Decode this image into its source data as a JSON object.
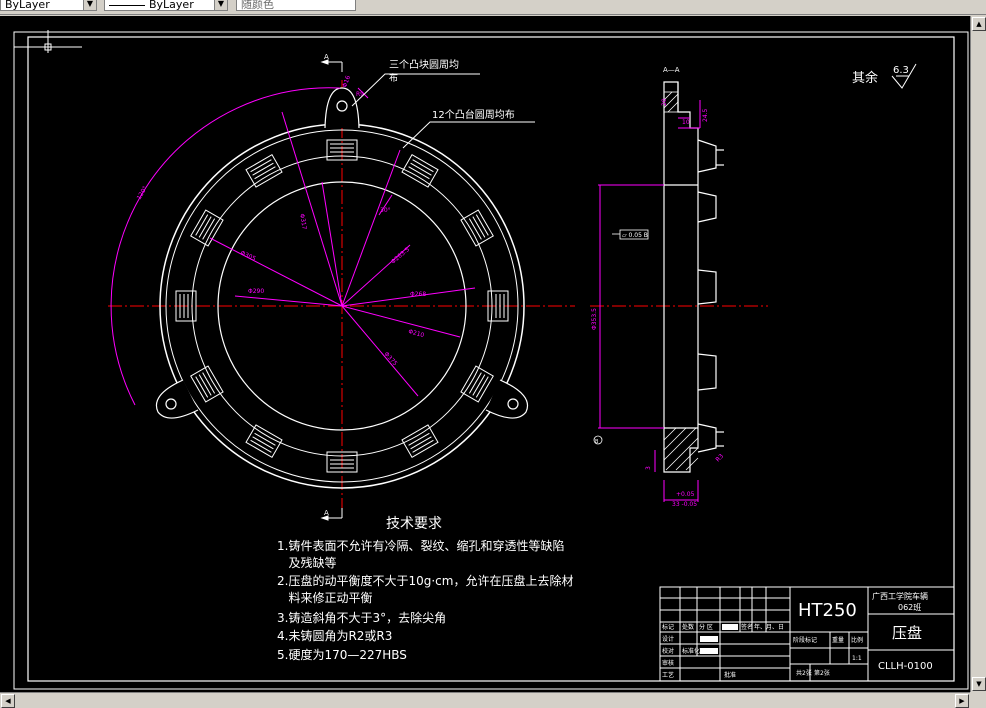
{
  "toolbar": {
    "layer_combo": "ByLayer",
    "linetype_combo": "ByLayer",
    "color_combo": "随颜色"
  },
  "drawing": {
    "annotation_bosses": "三个凸块圆周均",
    "annotation_bosses_2": "布",
    "annotation_pads": "12个凸台圆周均布",
    "section_label": "A—A",
    "datum_a": "A",
    "roughness_note": "其余",
    "roughness_value": "6.3",
    "flatness_frame": "⏥ 0.05 B",
    "datum_b": "B",
    "dim_outer_dia": "Φ375",
    "dim_mid_dia": "Φ317",
    "dim_inner_dia": "Φ210",
    "dim_h8": "Φ263.5",
    "dim_d1": "Φ16",
    "dim_d2": "R9",
    "dim_d3": "30°",
    "dim_d4": "Φ305",
    "dim_d5": "Φ290",
    "dim_d6": "Φ268",
    "dim_angle": "120°",
    "dim_vertical": "Φ353.5",
    "dim_thickness": "33 -0.05",
    "dim_thickness_tol": "+0.05",
    "dim_top": "20",
    "dim_top2": "10",
    "dim_top3": "24.5",
    "dim_small": "3",
    "dim_chamfer": "R3"
  },
  "requirements": {
    "title": "技术要求",
    "items": [
      "1.铸件表面不允许有冷隔、裂纹、缩孔和穿透性等缺陷",
      "   及残缺等",
      "2.压盘的动平衡度不大于10g·cm，允许在压盘上去除材",
      "   料来修正动平衡",
      "3.铸造斜角不大于3°，去除尖角",
      "4.未铸圆角为R2或R3",
      "5.硬度为170—227HBS"
    ]
  },
  "title_block": {
    "material": "HT250",
    "school": "广西工学院车辆",
    "class": "062班",
    "part_name": "压盘",
    "drawing_number": "CLLH-0100",
    "scale": "1:1",
    "stage_mark": "阶段标记",
    "weight": "重量",
    "ratio": "比例",
    "sheets_total": "共2张",
    "sheet_no": "第2张",
    "row_labels": [
      "标记",
      "设计",
      "校对",
      "审核",
      "工艺"
    ],
    "header_cells": [
      "标记",
      "处数",
      "分 区",
      "更改文件号",
      "签名",
      "年、月、日"
    ],
    "std_mark": "标准化",
    "approve": "批准"
  },
  "colors": {
    "background": "#000000",
    "geometry": "#ffffff",
    "dimension": "#ff00ff",
    "centerline": "#ff0000"
  }
}
